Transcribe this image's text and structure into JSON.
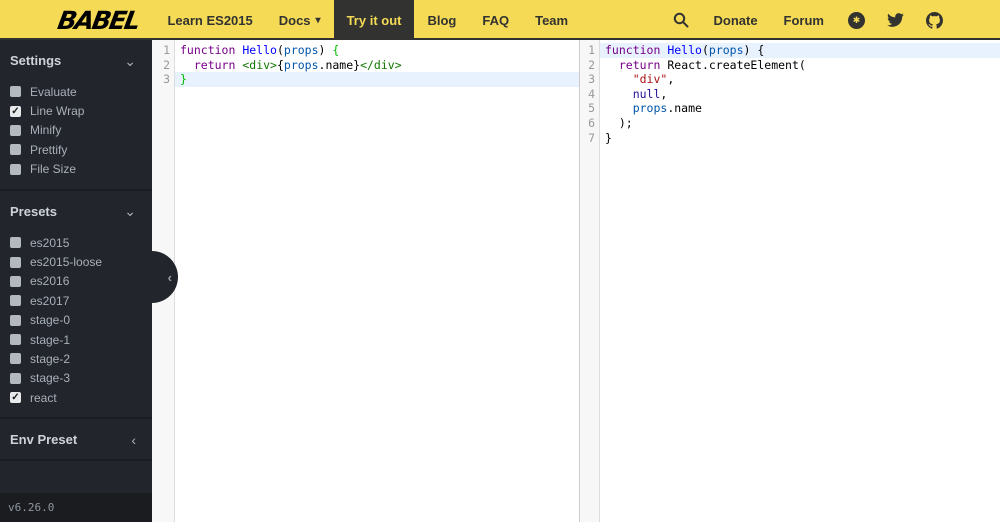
{
  "navbar": {
    "logo": "BABEL",
    "menu": [
      {
        "label": "Learn ES2015",
        "active": false,
        "has_caret": false
      },
      {
        "label": "Docs",
        "active": false,
        "has_caret": true
      },
      {
        "label": "Try it out",
        "active": true,
        "has_caret": false
      },
      {
        "label": "Blog",
        "active": false,
        "has_caret": false
      },
      {
        "label": "FAQ",
        "active": false,
        "has_caret": false
      },
      {
        "label": "Team",
        "active": false,
        "has_caret": false
      }
    ],
    "donate_label": "Donate",
    "forum_label": "Forum",
    "icons": [
      "search-icon",
      "opencollective-icon",
      "twitter-icon",
      "github-icon"
    ],
    "colors": {
      "bg": "#f5da55",
      "fg": "#323330",
      "active_bg": "#323330",
      "active_fg": "#f5da55"
    }
  },
  "sidebar": {
    "sections": [
      {
        "title": "Settings",
        "state": "expanded",
        "items": [
          {
            "label": "Evaluate",
            "checked": false
          },
          {
            "label": "Line Wrap",
            "checked": true
          },
          {
            "label": "Minify",
            "checked": false
          },
          {
            "label": "Prettify",
            "checked": false
          },
          {
            "label": "File Size",
            "checked": false
          }
        ]
      },
      {
        "title": "Presets",
        "state": "expanded",
        "items": [
          {
            "label": "es2015",
            "checked": false
          },
          {
            "label": "es2015-loose",
            "checked": false
          },
          {
            "label": "es2016",
            "checked": false
          },
          {
            "label": "es2017",
            "checked": false
          },
          {
            "label": "stage-0",
            "checked": false
          },
          {
            "label": "stage-1",
            "checked": false
          },
          {
            "label": "stage-2",
            "checked": false
          },
          {
            "label": "stage-3",
            "checked": false
          },
          {
            "label": "react",
            "checked": true
          }
        ]
      },
      {
        "title": "Env Preset",
        "state": "collapsed",
        "items": []
      }
    ],
    "version": "v6.26.0",
    "colors": {
      "bg": "#22252b",
      "version_bg": "#1a1c20"
    }
  },
  "editors": {
    "syntax_colors": {
      "k": "#708",
      "d": "#00f",
      "v": "#05a",
      "t": "#170",
      "s": "#a11",
      "a": "#219",
      "p": "#000",
      "m": "#0b0"
    },
    "active_line_color": "#e8f2ff",
    "input": {
      "active_line": 3,
      "lines": [
        [
          [
            "k",
            "function"
          ],
          [
            "p",
            " "
          ],
          [
            "d",
            "Hello"
          ],
          [
            "p",
            "("
          ],
          [
            "v",
            "props"
          ],
          [
            "p",
            ") "
          ],
          [
            "m",
            "{"
          ]
        ],
        [
          [
            "p",
            "  "
          ],
          [
            "k",
            "return"
          ],
          [
            "p",
            " "
          ],
          [
            "t",
            "<div>"
          ],
          [
            "p",
            "{"
          ],
          [
            "v",
            "props"
          ],
          [
            "p",
            ".name}"
          ],
          [
            "t",
            "</div>"
          ]
        ],
        [
          [
            "m",
            "}"
          ]
        ]
      ]
    },
    "output": {
      "active_line": 1,
      "lines": [
        [
          [
            "k",
            "function"
          ],
          [
            "p",
            " "
          ],
          [
            "d",
            "Hello"
          ],
          [
            "p",
            "("
          ],
          [
            "v",
            "props"
          ],
          [
            "p",
            ") "
          ],
          [
            "p",
            "{"
          ]
        ],
        [
          [
            "p",
            "  "
          ],
          [
            "k",
            "return"
          ],
          [
            "p",
            " "
          ],
          [
            "p",
            "React.createElement("
          ]
        ],
        [
          [
            "p",
            "    "
          ],
          [
            "s",
            "\"div\""
          ],
          [
            "p",
            ","
          ]
        ],
        [
          [
            "p",
            "    "
          ],
          [
            "a",
            "null"
          ],
          [
            "p",
            ","
          ]
        ],
        [
          [
            "p",
            "    "
          ],
          [
            "v",
            "props"
          ],
          [
            "p",
            ".name"
          ]
        ],
        [
          [
            "p",
            "  );"
          ]
        ],
        [
          [
            "p",
            "}"
          ]
        ]
      ]
    }
  }
}
